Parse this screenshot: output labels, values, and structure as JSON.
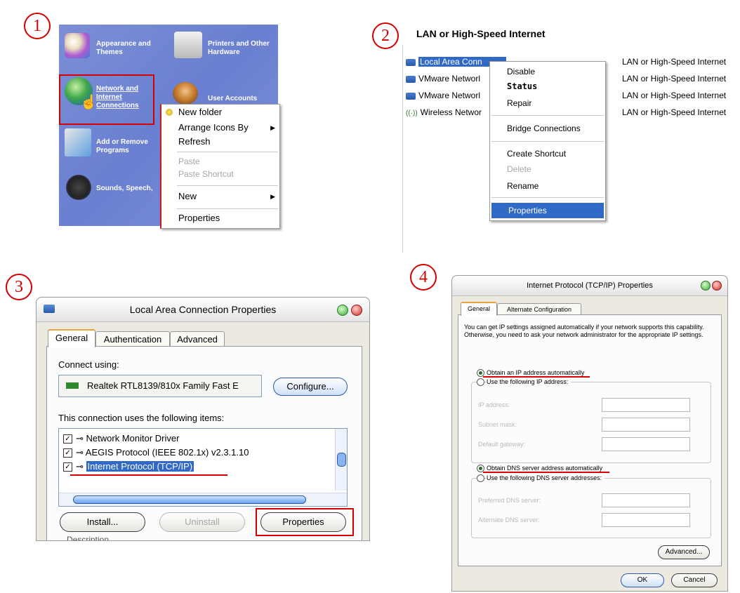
{
  "steps": [
    "1",
    "2",
    "3",
    "4"
  ],
  "panel1": {
    "cp_items": [
      {
        "label": "Appearance and Themes",
        "icon": "appearance-themes-icon"
      },
      {
        "label": "Printers and Other Hardware",
        "icon": "printer-icon"
      },
      {
        "label": "Network and Internet Connections",
        "icon": "network-globe-icon"
      },
      {
        "label": "User Accounts",
        "icon": "user-accounts-icon"
      },
      {
        "label": "Add or Remove Programs",
        "icon": "add-remove-programs-icon"
      },
      {
        "label": "Sounds, Speech,",
        "icon": "sounds-icon"
      }
    ],
    "context_menu": {
      "new_folder": "New folder",
      "arrange": "Arrange Icons By",
      "refresh": "Refresh",
      "paste": "Paste",
      "paste_shortcut": "Paste Shortcut",
      "new": "New",
      "properties": "Properties"
    }
  },
  "panel2": {
    "heading": "LAN or High-Speed Internet",
    "connections": [
      {
        "name": "Local Area Conn",
        "type": "LAN or High-Speed Internet"
      },
      {
        "name": "VMware Networl",
        "type": "LAN or High-Speed Internet"
      },
      {
        "name": "VMware Networl",
        "type": "LAN or High-Speed Internet"
      },
      {
        "name": "Wireless Networ",
        "type": "LAN or High-Speed Internet"
      }
    ],
    "menu": {
      "disable": "Disable",
      "status": "Status",
      "repair": "Repair",
      "bridge": "Bridge Connections",
      "create_shortcut": "Create Shortcut",
      "delete": "Delete",
      "rename": "Rename",
      "properties": "Properties"
    }
  },
  "panel3": {
    "title": "Local Area Connection Properties",
    "tabs": [
      "General",
      "Authentication",
      "Advanced"
    ],
    "connect_using": "Connect using:",
    "adapter": "Realtek RTL8139/810x Family Fast E",
    "configure": "Configure...",
    "items_label": "This connection uses the following items:",
    "items": [
      "Network Monitor Driver",
      "AEGIS Protocol (IEEE 802.1x) v2.3.1.10",
      "Internet Protocol (TCP/IP)"
    ],
    "install": "Install...",
    "uninstall": "Uninstall",
    "properties": "Properties",
    "description": "Description"
  },
  "panel4": {
    "title": "Internet Protocol (TCP/IP) Properties",
    "tabs": [
      "General",
      "Alternate Configuration"
    ],
    "intro": "You can get IP settings assigned automatically if your network supports this capability. Otherwise, you need to ask your network administrator for the appropriate IP settings.",
    "obtain_ip": "Obtain an IP address automatically",
    "use_ip": "Use the following IP address:",
    "ip_address": "IP address:",
    "subnet": "Subnet mask:",
    "gateway": "Default gateway:",
    "obtain_dns": "Obtain DNS server address automatically",
    "use_dns": "Use the following DNS server addresses:",
    "pref_dns": "Preferred DNS server:",
    "alt_dns": "Alternate DNS server:",
    "advanced": "Advanced...",
    "ok": "OK",
    "cancel": "Cancel"
  },
  "colors": {
    "highlight": "#3169c6",
    "annotation_red": "#d40000",
    "cp_blue": "#7186d4"
  }
}
